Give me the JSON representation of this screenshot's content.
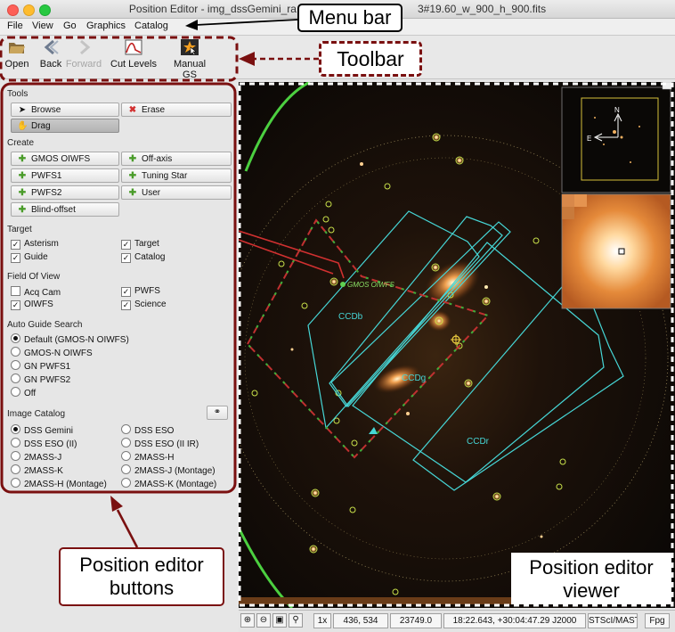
{
  "window": {
    "title": "Position Editor - img_dssGemini_ra",
    "title_tail": "3#19.60_w_900_h_900.fits"
  },
  "menu": [
    "File",
    "View",
    "Go",
    "Graphics",
    "Catalog"
  ],
  "toolbar": {
    "open": "Open",
    "back": "Back",
    "forward": "Forward",
    "cut_levels": "Cut Levels",
    "manual_gs": "Manual GS"
  },
  "tools": {
    "heading": "Tools",
    "browse": "Browse",
    "erase": "Erase",
    "drag": "Drag"
  },
  "create": {
    "heading": "Create",
    "gmos_oiwfs": "GMOS OIWFS",
    "off_axis": "Off-axis",
    "pwfs1": "PWFS1",
    "tuning_star": "Tuning Star",
    "pwfs2": "PWFS2",
    "user": "User",
    "blind_offset": "Blind-offset"
  },
  "target": {
    "heading": "Target",
    "asterism": "Asterism",
    "target": "Target",
    "guide": "Guide",
    "catalog": "Catalog"
  },
  "fov": {
    "heading": "Field Of View",
    "acq_cam": "Acq Cam",
    "pwfs": "PWFS",
    "oiwfs": "OIWFS",
    "science": "Science"
  },
  "auto_guide": {
    "heading": "Auto Guide Search",
    "opt_default": "Default (GMOS-N OIWFS)",
    "opt_gmos": "GMOS-N OIWFS",
    "opt_pwfs1": "GN PWFS1",
    "opt_pwfs2": "GN PWFS2",
    "opt_off": "Off"
  },
  "image_catalog": {
    "heading": "Image Catalog",
    "dss_gemini": "DSS Gemini",
    "dss_eso": "DSS ESO",
    "dss_eso_ii": "DSS ESO (II)",
    "dss_eso_ii_ir": "DSS ESO (II IR)",
    "twomass_j": "2MASS-J",
    "twomass_h": "2MASS-H",
    "twomass_k": "2MASS-K",
    "twomass_j_montage": "2MASS-J (Montage)",
    "twomass_h_montage": "2MASS-H (Montage)",
    "twomass_k_montage": "2MASS-K (Montage)"
  },
  "viewer": {
    "label_gmos": "GMOS OIWFS",
    "label_ccdb": "CCDb",
    "label_ccdg": "CCDg",
    "label_ccdr": "CCDr",
    "compass_n": "N",
    "compass_e": "E"
  },
  "status": {
    "zoom": "1x",
    "pixel": "436, 534",
    "value": "23749.0",
    "coords": "18:22.643, +30:04:47.29 J2000",
    "archive": "STScI/MAST",
    "fpg": "Fpg"
  },
  "callouts": {
    "menu_bar": "Menu bar",
    "toolbar": "Toolbar",
    "editor_buttons": "Position editor buttons",
    "editor_viewer": "Position editor viewer"
  }
}
